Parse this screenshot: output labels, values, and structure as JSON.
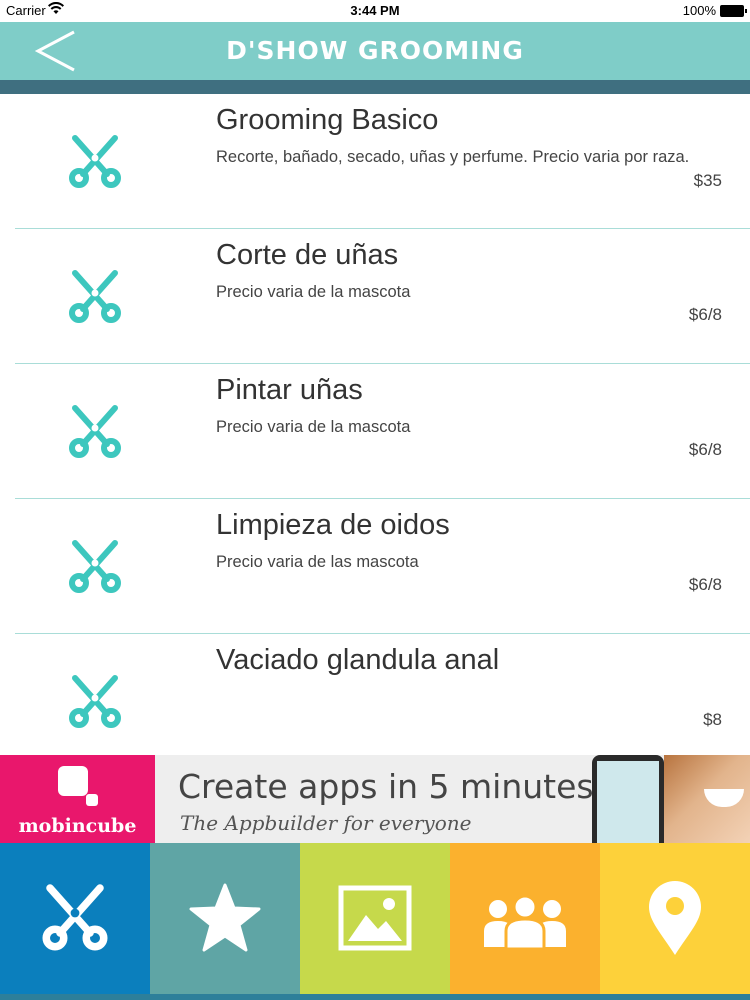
{
  "status_bar": {
    "carrier": "Carrier",
    "time": "3:44 PM",
    "battery": "100%"
  },
  "nav": {
    "title": "D'SHOW GROOMING",
    "back_icon": "chevron-left-icon"
  },
  "services": [
    {
      "name": "Grooming Basico",
      "description": "Recorte, bañado, secado, uñas y perfume. Precio varia por raza.",
      "price": "$35",
      "icon": "scissors-icon"
    },
    {
      "name": "Corte de uñas",
      "description": "Precio varia de la mascota",
      "price": "$6/8",
      "icon": "scissors-icon"
    },
    {
      "name": "Pintar uñas",
      "description": "Precio varia de la mascota",
      "price": "$6/8",
      "icon": "scissors-icon"
    },
    {
      "name": "Limpieza de oidos",
      "description": "Precio varia de las mascota",
      "price": "$6/8",
      "icon": "scissors-icon"
    },
    {
      "name": "Vaciado glandula anal",
      "description": "",
      "price": "$8",
      "icon": "scissors-icon"
    }
  ],
  "ad": {
    "brand": "mobincube",
    "headline": "Create apps in 5 minutes",
    "tagline": "The Appbuilder for everyone"
  },
  "tabs": [
    {
      "icon": "scissors-icon",
      "color": "#0b7fbd"
    },
    {
      "icon": "star-icon",
      "color": "#5fa5a5"
    },
    {
      "icon": "image-icon",
      "color": "#c6d94b"
    },
    {
      "icon": "group-icon",
      "color": "#fbb12e"
    },
    {
      "icon": "map-pin-icon",
      "color": "#fdd13a"
    }
  ],
  "colors": {
    "accent": "#7fcdc8",
    "icon_teal": "#3dc7be",
    "divider": "#a9ddd8"
  }
}
